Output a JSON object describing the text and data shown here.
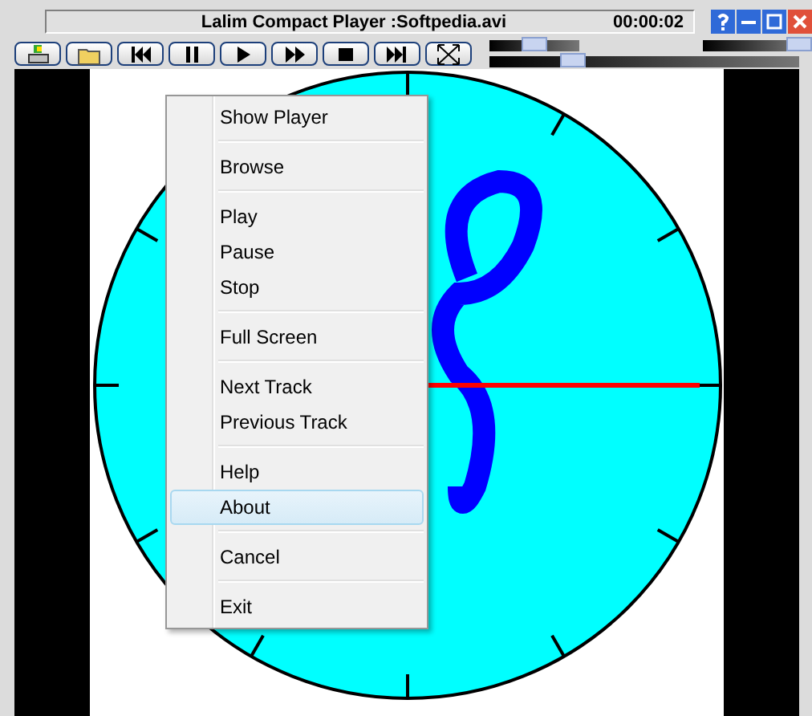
{
  "window": {
    "title": "Lalim Compact Player :Softpedia.avi",
    "time": "00:00:02"
  },
  "sliders": [
    {
      "level": 0.5
    },
    {
      "level": 1.0
    },
    {
      "level": 0.27
    }
  ],
  "menu": {
    "groups": [
      [
        {
          "label": "Show Player",
          "selected": false
        }
      ],
      [
        {
          "label": "Browse",
          "selected": false
        }
      ],
      [
        {
          "label": "Play",
          "selected": false
        },
        {
          "label": "Pause",
          "selected": false
        },
        {
          "label": "Stop",
          "selected": false
        }
      ],
      [
        {
          "label": "Full Screen",
          "selected": false
        }
      ],
      [
        {
          "label": "Next Track",
          "selected": false
        },
        {
          "label": "Previous Track",
          "selected": false
        }
      ],
      [
        {
          "label": "Help",
          "selected": false
        },
        {
          "label": "About",
          "selected": true
        }
      ],
      [
        {
          "label": "Cancel",
          "selected": false
        }
      ],
      [
        {
          "label": "Exit",
          "selected": false
        }
      ]
    ]
  }
}
